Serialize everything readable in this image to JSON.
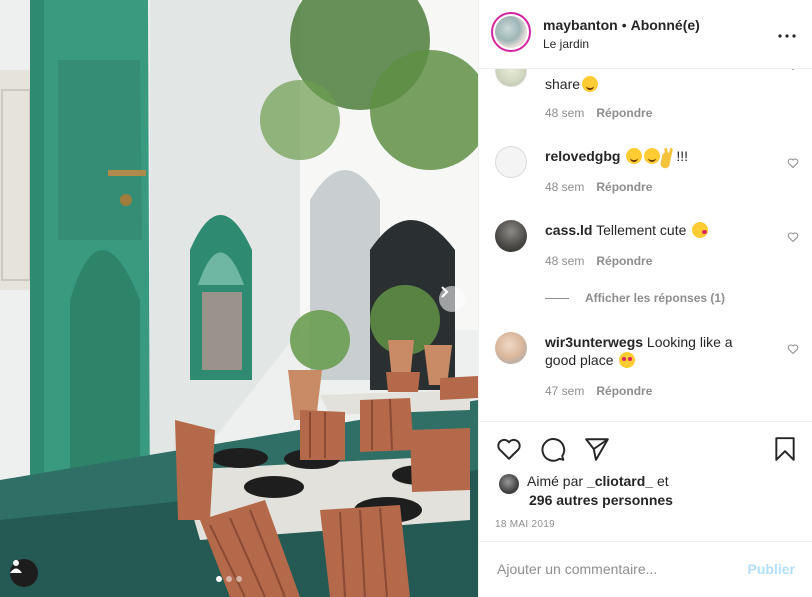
{
  "header": {
    "username": "maybanton",
    "separator": "•",
    "follow_status": "Abonné(e)",
    "location": "Le jardin",
    "more_icon": "more-horizontal-icon"
  },
  "comments": [
    {
      "partial_text": "share",
      "time": "48 sem",
      "reply_label": "Répondre"
    },
    {
      "username": "relovedgbg",
      "text": "!!!",
      "time": "48 sem",
      "reply_label": "Répondre"
    },
    {
      "username": "cass.ld",
      "text": "Tellement cute",
      "time": "48 sem",
      "reply_label": "Répondre"
    },
    {
      "username": "wir3unterwegs",
      "text": "Looking like a good place",
      "time": "47 sem",
      "reply_label": "Répondre"
    }
  ],
  "view_replies": "Afficher les réponses (1)",
  "actions": {
    "like_icon": "heart-icon",
    "comment_icon": "comment-icon",
    "share_icon": "paper-plane-icon",
    "save_icon": "bookmark-icon"
  },
  "likes": {
    "prefix": "Aimé par",
    "user": "_cliotard_",
    "suffix": "et",
    "others": "296 autres personnes"
  },
  "date": "18 MAI 2019",
  "add_comment": {
    "placeholder": "Ajouter un commentaire...",
    "post_label": "Publier"
  },
  "colors": {
    "accent_disabled": "#b2dffc",
    "secondary_text": "#8e8e8e",
    "story_ring": "#d6249f"
  }
}
